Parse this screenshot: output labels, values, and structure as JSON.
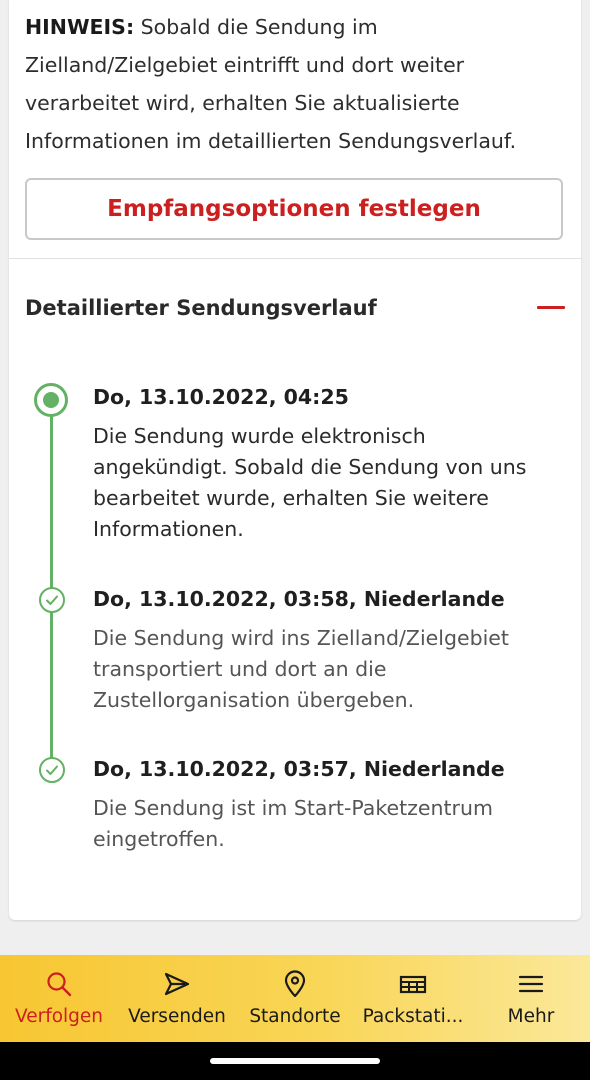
{
  "notice": {
    "label": "HINWEIS:",
    "text": " Sobald die Sendung im Zielland/Zielgebiet eintrifft und dort weiter verarbeitet wird, erhalten Sie aktualisierte Informationen im detaillierten Sendungsverlauf."
  },
  "delivery_options_button": "Empfangsoptionen festlegen",
  "history": {
    "title": "Detaillierter Sendungsverlauf",
    "collapse_icon": "minus-icon",
    "events": [
      {
        "date": "Do, 13.10.2022, 04:25",
        "text": "Die Sendung wurde elektronisch angekündigt. Sobald die Sendung von uns bearbeitet wurde, erhalten Sie weitere Informationen.",
        "status": "current"
      },
      {
        "date": "Do, 13.10.2022, 03:58, Niederlande",
        "text": "Die Sendung wird ins Zielland/Zielgebiet transportiert und dort an die Zustellorganisation übergeben.",
        "status": "done"
      },
      {
        "date": "Do, 13.10.2022, 03:57, Niederlande",
        "text": "Die Sendung ist im Start-Paketzentrum eingetroffen.",
        "status": "done"
      }
    ]
  },
  "nav": {
    "items": [
      {
        "label": "Verfolgen",
        "icon": "search-icon",
        "active": true
      },
      {
        "label": "Versenden",
        "icon": "send-icon",
        "active": false
      },
      {
        "label": "Standorte",
        "icon": "location-pin-icon",
        "active": false
      },
      {
        "label": "Packstati...",
        "icon": "packstation-icon",
        "active": false
      },
      {
        "label": "Mehr",
        "icon": "menu-icon",
        "active": false
      }
    ]
  },
  "colors": {
    "accent_red": "#cc1f1f",
    "timeline_green": "#63b163",
    "nav_yellow": "#f7c632"
  }
}
